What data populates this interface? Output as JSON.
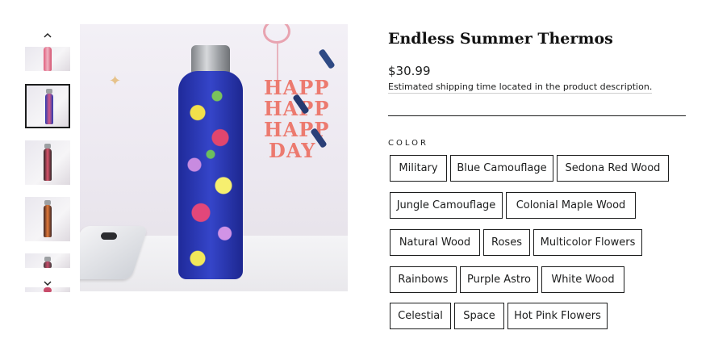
{
  "product": {
    "title": "Endless Summer Thermos",
    "price": "$30.99",
    "shipping_note": "Estimated shipping time located in the product description."
  },
  "gallery": {
    "nav_up_icon": "chevron-up-icon",
    "nav_down_icon": "chevron-down-icon",
    "main_photo_text": "HAPPY HAPPY HAPPY DAY",
    "main_photo_lines": [
      "HAPP",
      "HAPP",
      "HAPP",
      "DAY"
    ]
  },
  "option": {
    "label": "COLOR",
    "values": [
      "Military",
      "Blue Camouflage",
      "Sedona Red Wood",
      "Jungle Camouflage",
      "Colonial Maple Wood",
      "Natural Wood",
      "Roses",
      "Multicolor Flowers",
      "Rainbows",
      "Purple Astro",
      "White Wood",
      "Celestial",
      "Space",
      "Hot Pink Flowers"
    ]
  },
  "colors": {
    "text": "#1c1d1d",
    "border": "#1c1d1d",
    "background": "#ffffff"
  }
}
